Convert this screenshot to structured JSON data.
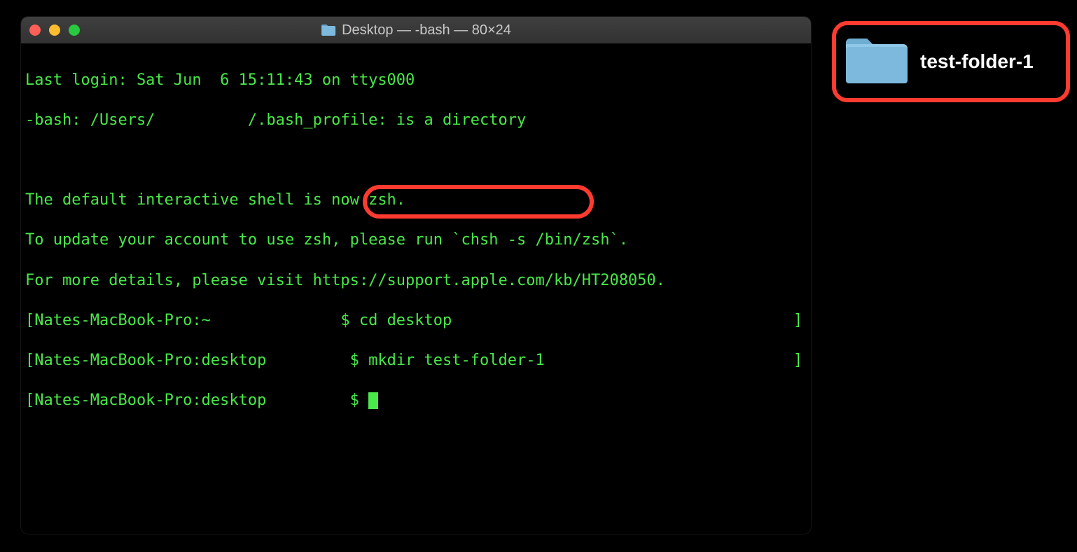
{
  "window": {
    "title": "Desktop — -bash — 80×24"
  },
  "terminal": {
    "line1": "Last login: Sat Jun  6 15:11:43 on ttys000",
    "line2": "-bash: /Users/          /.bash_profile: is a directory",
    "blank1": " ",
    "line3": "The default interactive shell is now zsh.",
    "line4": "To update your account to use zsh, please run `chsh -s /bin/zsh`.",
    "line5": "For more details, please visit https://support.apple.com/kb/HT208050.",
    "line6_prompt": "[Nates-MacBook-Pro:~              $ ",
    "line6_cmd": "cd desktop",
    "line7_prompt": "[Nates-MacBook-Pro:desktop         $ ",
    "line7_cmd": "mkdir test-folder-1",
    "line8_prompt": "[Nates-MacBook-Pro:desktop         $ ",
    "bracket_right": "]"
  },
  "desktop_item": {
    "label": "test-folder-1"
  },
  "colors": {
    "highlight": "#ff3b30",
    "terminal_text": "#48e848",
    "folder_blue": "#7db9dd"
  }
}
